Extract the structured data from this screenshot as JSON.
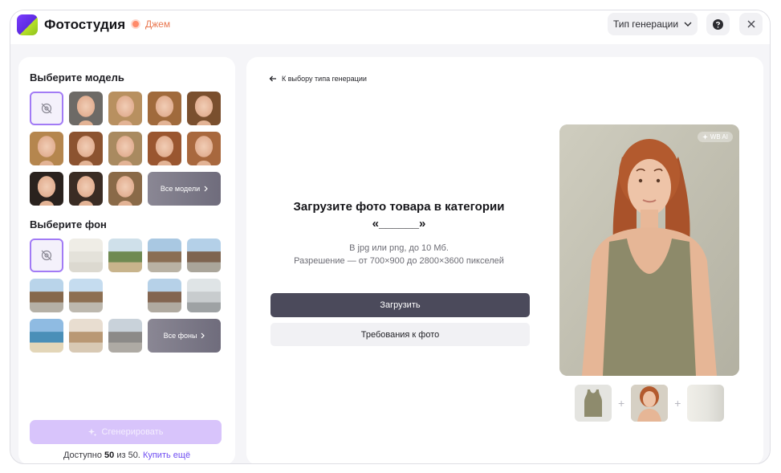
{
  "header": {
    "app_title": "Фотостудия",
    "user_name": "Джем",
    "gen_type_label": "Тип генерации",
    "help_icon": "question-circle-icon",
    "close_icon": "close-icon"
  },
  "sidebar": {
    "model_section_title": "Выберите модель",
    "all_models_label": "Все модели",
    "background_section_title": "Выберите фон",
    "all_backgrounds_label": "Все фоны",
    "generate_label": "Сгенерировать",
    "available_prefix": "Доступно",
    "available_count": "50",
    "available_total": "из 50.",
    "buy_more_label": "Купить ещё"
  },
  "main": {
    "back_label": "К выбору типа генерации",
    "upload_title_line1": "Загрузите фото товара в категории",
    "upload_title_line2": "«______»",
    "hint_line1": "В jpg или png, до 10 Мб.",
    "hint_line2": "Разрешение — от 700×900 до 2800×3600 пикселей",
    "upload_button": "Загрузить",
    "requirements_button": "Требования к фото",
    "preview_badge": "WB AI"
  },
  "colors": {
    "accent": "#7b3cff",
    "primary_button": "#4b4a5b",
    "generate_disabled": "#d8c4fb",
    "user_badge": "#e9774f",
    "link": "#6f4df2"
  }
}
